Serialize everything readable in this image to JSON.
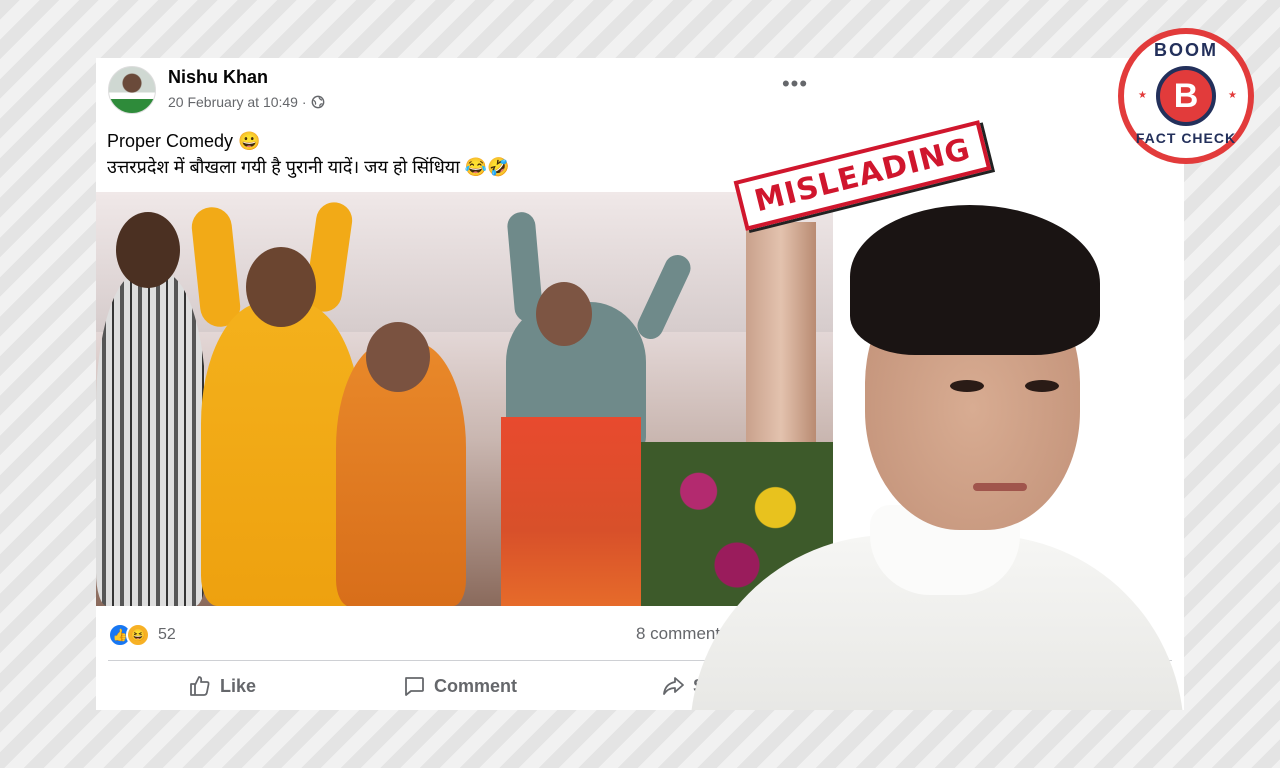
{
  "post": {
    "author": "Nishu Khan",
    "timestamp": "20 February at 10:49 ·",
    "caption_line1": "Proper Comedy 😀",
    "caption_line2": "उत्तरप्रदेश में बौखला गयी है पुरानी यादें। जय हो सिंधिया 😂🤣",
    "reaction_count": "52",
    "comments_shares": "8 comments  6 sh",
    "actions": {
      "like": "Like",
      "comment": "Comment",
      "share": "S"
    }
  },
  "overlay": {
    "stamp_label": "MISLEADING",
    "badge_top": "BOOM",
    "badge_letter": "B",
    "badge_bottom": "FACT CHECK"
  },
  "icons": {
    "globe": "globe-icon",
    "more": "more-options-icon",
    "mute": "mute-icon",
    "like": "thumbs-up-icon",
    "comment": "comment-icon",
    "share": "share-icon"
  },
  "colors": {
    "facebook_blue": "#1877f2",
    "stamp_red": "#d0162d",
    "badge_red": "#e23b3b",
    "badge_navy": "#23305b"
  }
}
